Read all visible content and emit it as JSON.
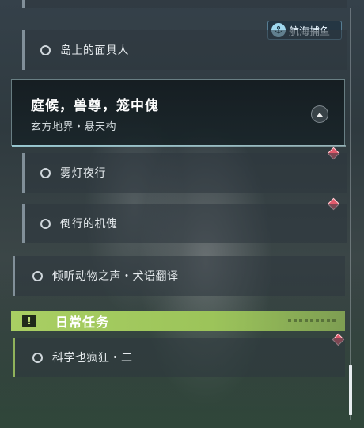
{
  "quest_list": {
    "top_partial_label": "",
    "sub_quest_1": "岛上的面具人",
    "active": {
      "title": "庭候，兽尊，笼中傀",
      "location": "玄方地界・悬天构"
    },
    "sub_quest_2": "雾灯夜行",
    "sub_quest_3": "倒行的机傀",
    "side_quest": "倾听动物之声・犬语翻译",
    "daily_section": {
      "header": "日常任务",
      "icon_glyph": "!",
      "items": [
        "科学也疯狂・二"
      ]
    }
  },
  "tag": {
    "label": "航海捕鱼",
    "icon": "anchor-icon"
  },
  "colors": {
    "daily_accent": "#a9cf63",
    "marker": "#e05a6c"
  }
}
